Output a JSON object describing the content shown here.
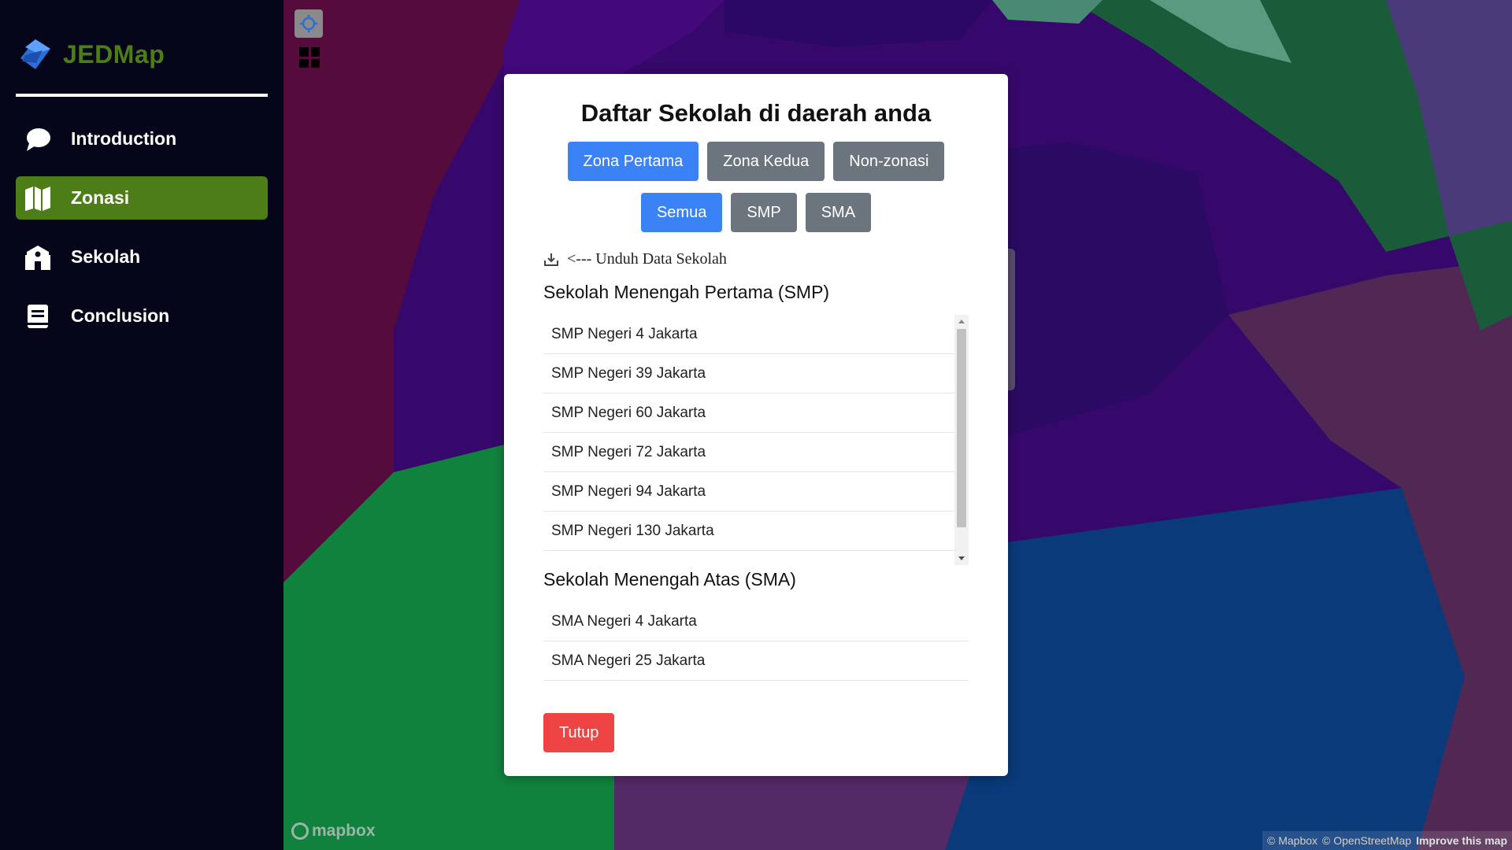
{
  "brand": {
    "name": "JEDMap",
    "color": "#4d7d16"
  },
  "sidebar": {
    "items": [
      {
        "label": "Introduction",
        "icon": "chat-bubble-icon",
        "active": false
      },
      {
        "label": "Zonasi",
        "icon": "map-icon",
        "active": true
      },
      {
        "label": "Sekolah",
        "icon": "school-icon",
        "active": false
      },
      {
        "label": "Conclusion",
        "icon": "document-icon",
        "active": false
      }
    ]
  },
  "modal": {
    "title": "Daftar Sekolah di daerah anda",
    "zone_tabs": [
      {
        "label": "Zona Pertama",
        "selected": true
      },
      {
        "label": "Zona Kedua",
        "selected": false
      },
      {
        "label": "Non-zonasi",
        "selected": false
      }
    ],
    "level_tabs": [
      {
        "label": "Semua",
        "selected": true
      },
      {
        "label": "SMP",
        "selected": false
      },
      {
        "label": "SMA",
        "selected": false
      }
    ],
    "download_label": "<--- Unduh Data Sekolah",
    "smp": {
      "title": "Sekolah Menengah Pertama (SMP)",
      "items": [
        "SMP Negeri 4 Jakarta",
        "SMP Negeri 39 Jakarta",
        "SMP Negeri 60 Jakarta",
        "SMP Negeri 72 Jakarta",
        "SMP Negeri 94 Jakarta",
        "SMP Negeri 130 Jakarta"
      ]
    },
    "sma": {
      "title": "Sekolah Menengah Atas (SMA)",
      "items": [
        "SMA Negeri 4 Jakarta",
        "SMA Negeri 25 Jakarta"
      ]
    },
    "close_label": "Tutup"
  },
  "map": {
    "logo_text": "mapbox",
    "attribution": {
      "mapbox": "© Mapbox",
      "osm": "© OpenStreetMap",
      "improve": "Improve this map"
    }
  },
  "colors": {
    "primary": "#3b82f6",
    "secondary": "#6c757d",
    "danger": "#ef4444",
    "sidebar_bg": "#06061a"
  }
}
